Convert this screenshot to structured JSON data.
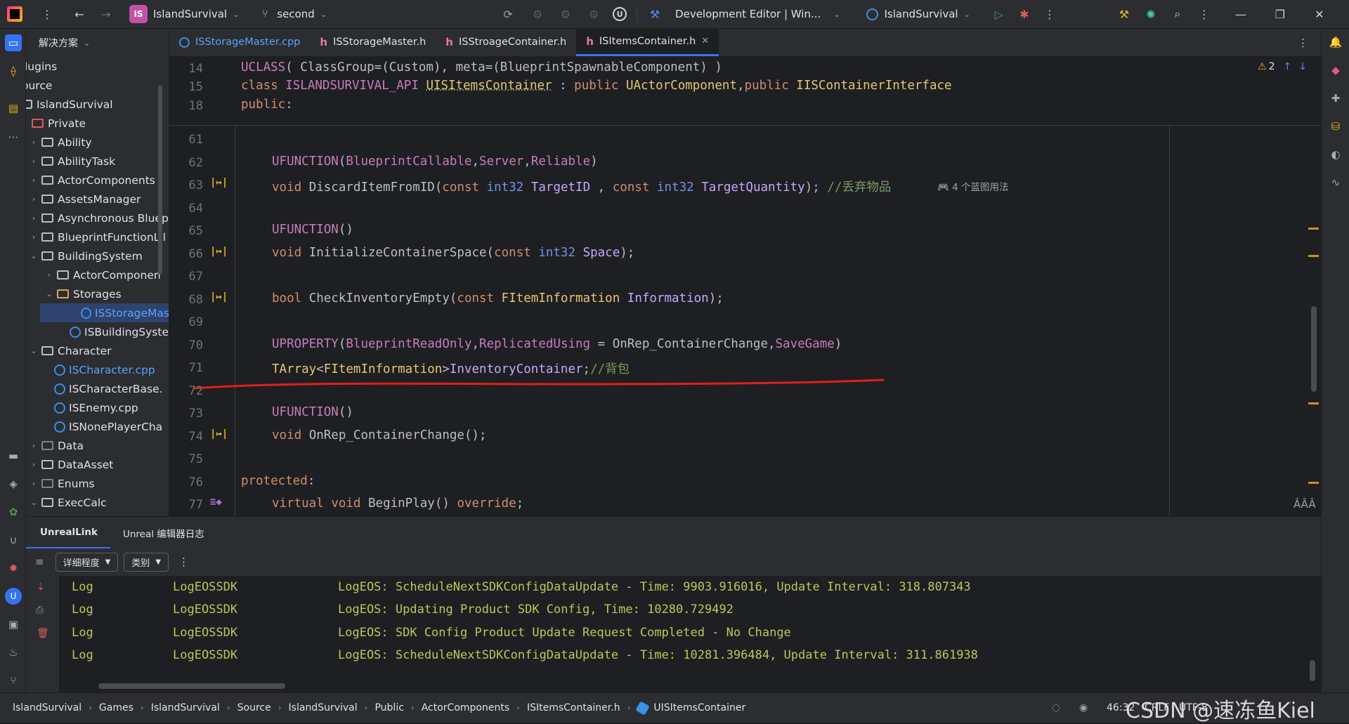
{
  "titlebar": {
    "project_badge": "IS",
    "project_name": "IslandSurvival",
    "branch": "second",
    "run_config": "Development Editor | Win...",
    "target": "IslandSurvival"
  },
  "project_panel": {
    "header": "解决方案",
    "rows": [
      {
        "label": "lugins"
      },
      {
        "label": "ource"
      },
      {
        "label": "IslandSurvival"
      },
      {
        "label": "Private"
      },
      {
        "label": "Ability"
      },
      {
        "label": "AbilityTask"
      },
      {
        "label": "ActorComponents"
      },
      {
        "label": "AssetsManager"
      },
      {
        "label": "Asynchronous Bluep"
      },
      {
        "label": "BlueprintFunctionLil"
      },
      {
        "label": "BuildingSystem"
      },
      {
        "label": "ActorComponen"
      },
      {
        "label": "Storages"
      },
      {
        "label": "ISStorageMas"
      },
      {
        "label": "ISBuildingSystem"
      },
      {
        "label": "Character"
      },
      {
        "label": "ISCharacter.cpp"
      },
      {
        "label": "ISCharacterBase."
      },
      {
        "label": "ISEnemy.cpp"
      },
      {
        "label": "ISNonePlayerCha"
      },
      {
        "label": "Data"
      },
      {
        "label": "DataAsset"
      },
      {
        "label": "Enums"
      },
      {
        "label": "ExecCalc"
      }
    ]
  },
  "tabs": [
    {
      "label": "ISStorageMaster.cpp",
      "kind": "cpp"
    },
    {
      "label": "ISStorageMaster.h",
      "kind": "h"
    },
    {
      "label": "ISStroageContainer.h",
      "kind": "h"
    },
    {
      "label": "ISItemsContainer.h",
      "kind": "h",
      "active": true
    }
  ],
  "editor": {
    "warnings": "2",
    "sticky": [
      {
        "line": "14"
      },
      {
        "line": "15"
      },
      {
        "line": "18"
      }
    ],
    "lines": [
      "61",
      "62",
      "63",
      "64",
      "65",
      "66",
      "67",
      "68",
      "69",
      "70",
      "71",
      "72",
      "73",
      "74",
      "75",
      "76",
      "77"
    ],
    "inlay_hint": "4 个蓝图用法",
    "comment_discard": "//丢弃物品",
    "comment_bag": "//背包"
  },
  "bottom_panel": {
    "tabs": [
      "UnrealLink",
      "Unreal 编辑器日志"
    ],
    "verbosity": "详细程度",
    "category": "类别",
    "logs": [
      {
        "level": "Log",
        "category": "LogEOSSDK",
        "message": "LogEOS: ScheduleNextSDKConfigDataUpdate - Time: 9903.916016, Update Interval: 318.807343"
      },
      {
        "level": "Log",
        "category": "LogEOSSDK",
        "message": "LogEOS: Updating Product SDK Config, Time: 10280.729492"
      },
      {
        "level": "Log",
        "category": "LogEOSSDK",
        "message": "LogEOS: SDK Config Product Update Request Completed - No Change"
      },
      {
        "level": "Log",
        "category": "LogEOSSDK",
        "message": "LogEOS: ScheduleNextSDKConfigDataUpdate - Time: 10281.396484, Update Interval: 311.861938"
      }
    ]
  },
  "statusbar": {
    "breadcrumbs": [
      "IslandSurvival",
      "Games",
      "IslandSurvival",
      "Source",
      "IslandSurvival",
      "Public",
      "ActorComponents",
      "ISItemsContainer.h",
      "UISItemsContainer"
    ],
    "position": "46:32",
    "line_ending": "CRLF",
    "encoding": "UTF-8",
    "watermark": "CSDN @速冻鱼Kiel"
  },
  "colors": {
    "accent": "#3574f0",
    "annotation_red": "#e0201a"
  }
}
